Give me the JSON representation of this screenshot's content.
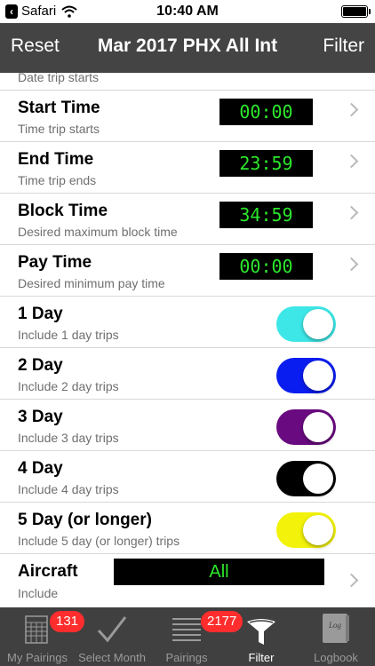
{
  "status_bar": {
    "carrier": "Safari",
    "time": "10:40 AM"
  },
  "nav": {
    "left": "Reset",
    "title": "Mar 2017 PHX All Int",
    "right": "Filter"
  },
  "partial_row": {
    "subtitle": "Date trip starts"
  },
  "time_rows": [
    {
      "title": "Start Time",
      "subtitle": "Time trip starts",
      "value": "00:00"
    },
    {
      "title": "End Time",
      "subtitle": "Time trip ends",
      "value": "23:59"
    },
    {
      "title": "Block Time",
      "subtitle": "Desired maximum block time",
      "value": "34:59"
    },
    {
      "title": "Pay Time",
      "subtitle": "Desired minimum pay time",
      "value": "00:00"
    }
  ],
  "toggle_rows": [
    {
      "title": "1 Day",
      "subtitle": "Include 1 day trips",
      "color": "#3ee7e7",
      "on": true
    },
    {
      "title": "2 Day",
      "subtitle": "Include 2 day trips",
      "color": "#0a1df0",
      "on": true
    },
    {
      "title": "3 Day",
      "subtitle": "Include 3 day trips",
      "color": "#6a0a80",
      "on": true
    },
    {
      "title": "4 Day",
      "subtitle": "Include 4 day trips",
      "color": "#000000",
      "on": true
    },
    {
      "title": "5 Day (or longer)",
      "subtitle": "Include 5 day (or longer) trips",
      "color": "#f2f20a",
      "on": true
    }
  ],
  "aircraft_row": {
    "title": "Aircraft",
    "subtitle": "Include",
    "value": "All"
  },
  "tabs": [
    {
      "label": "My Pairings",
      "badge": "131",
      "icon": "calendar-icon"
    },
    {
      "label": "Select Month",
      "badge": "",
      "icon": "checkmark-icon"
    },
    {
      "label": "Pairings",
      "badge": "2177",
      "icon": "list-icon"
    },
    {
      "label": "Filter",
      "badge": "",
      "icon": "filter-icon",
      "active": true
    },
    {
      "label": "Logbook",
      "badge": "",
      "icon": "logbook-icon",
      "icon_text": "Log"
    }
  ]
}
